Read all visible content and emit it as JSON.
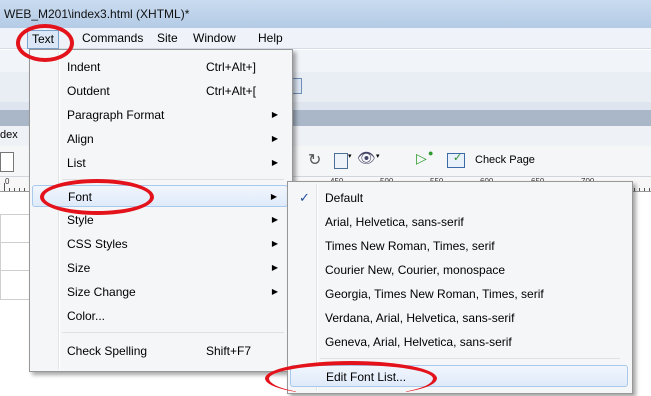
{
  "window": {
    "title": "WEB_M201\\index3.html (XHTML)*"
  },
  "menubar": {
    "items": [
      "Text",
      "Commands",
      "Site",
      "Window",
      "Help"
    ]
  },
  "doc_toolbar": {
    "check_page_label": "Check Page",
    "tab_fragment": "dex",
    "ruler_labels": [
      "450",
      "500",
      "550",
      "600",
      "650",
      "700"
    ]
  },
  "text_menu": {
    "items": [
      {
        "label": "Indent",
        "shortcut": "Ctrl+Alt+]",
        "submenu": false
      },
      {
        "label": "Outdent",
        "shortcut": "Ctrl+Alt+[",
        "submenu": false
      },
      {
        "label": "Paragraph Format",
        "shortcut": "",
        "submenu": true
      },
      {
        "label": "Align",
        "shortcut": "",
        "submenu": true
      },
      {
        "label": "List",
        "shortcut": "",
        "submenu": true
      },
      {
        "label": "Font",
        "shortcut": "",
        "submenu": true,
        "highlighted": true
      },
      {
        "label": "Style",
        "shortcut": "",
        "submenu": true
      },
      {
        "label": "CSS Styles",
        "shortcut": "",
        "submenu": true
      },
      {
        "label": "Size",
        "shortcut": "",
        "submenu": true
      },
      {
        "label": "Size Change",
        "shortcut": "",
        "submenu": true
      },
      {
        "label": "Color...",
        "shortcut": "",
        "submenu": false
      },
      {
        "label": "Check Spelling",
        "shortcut": "Shift+F7",
        "submenu": false
      }
    ]
  },
  "font_menu": {
    "items": [
      {
        "label": "Default",
        "checked": true
      },
      {
        "label": "Arial, Helvetica, sans-serif"
      },
      {
        "label": "Times New Roman, Times, serif"
      },
      {
        "label": "Courier New, Courier, monospace"
      },
      {
        "label": "Georgia, Times New Roman, Times, serif"
      },
      {
        "label": "Verdana, Arial, Helvetica, sans-serif"
      },
      {
        "label": "Geneva, Arial, Helvetica, sans-serif"
      },
      {
        "label": "Edit Font List...",
        "highlighted": true
      }
    ]
  },
  "icons": {
    "submenu_arrow": "▶",
    "check": "✓"
  },
  "colors": {
    "annotation_ring": "#e3121b",
    "menu_highlight": "#dfeafa"
  }
}
